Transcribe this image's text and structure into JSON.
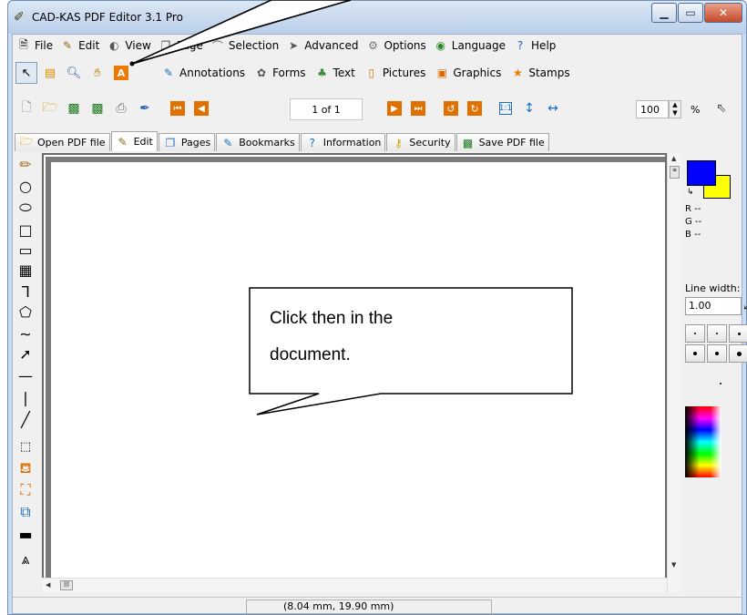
{
  "window": {
    "title": "CAD-KAS PDF Editor 3.1 Pro"
  },
  "menu": [
    {
      "label": "File",
      "icon": "file-icon"
    },
    {
      "label": "Edit",
      "icon": "edit-icon"
    },
    {
      "label": "View",
      "icon": "view-icon"
    },
    {
      "label": "Page",
      "icon": "page-icon"
    },
    {
      "label": "Selection",
      "icon": "selection-icon"
    },
    {
      "label": "Advanced",
      "icon": "advanced-icon"
    },
    {
      "label": "Options",
      "icon": "options-icon"
    },
    {
      "label": "Language",
      "icon": "language-icon"
    },
    {
      "label": "Help",
      "icon": "help-icon"
    }
  ],
  "toolbar2": {
    "labels": [
      "Annotations",
      "Forms",
      "Text",
      "Pictures",
      "Graphics",
      "Stamps"
    ]
  },
  "toolbar3": {
    "page_indicator": "1 of 1",
    "zoom": "100",
    "zoom_unit": "%"
  },
  "tabs": [
    {
      "label": "Open PDF file"
    },
    {
      "label": "Edit"
    },
    {
      "label": "Pages"
    },
    {
      "label": "Bookmarks"
    },
    {
      "label": "Information"
    },
    {
      "label": "Security"
    },
    {
      "label": "Save PDF file"
    }
  ],
  "right_panel": {
    "r": "R --",
    "g": "G --",
    "b": "B --",
    "line_width_label": "Line width:",
    "line_width_value": "1.00",
    "colors": {
      "foreground": "#0000ff",
      "background": "#ffff00"
    }
  },
  "status": {
    "coords": "(8.04 mm, 19.90 mm)"
  },
  "callout": {
    "line1": "Click then in the",
    "line2": "document."
  }
}
